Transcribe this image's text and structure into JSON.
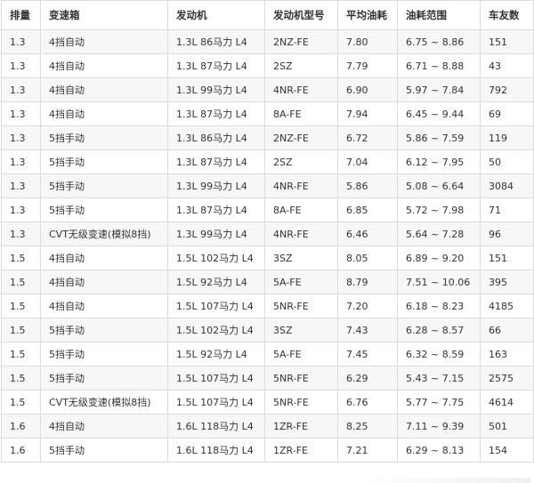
{
  "table": {
    "headers": [
      "排量",
      "变速箱",
      "发动机",
      "发动机型号",
      "平均油耗",
      "油耗范围",
      "车友数"
    ],
    "rows": [
      [
        "1.3",
        "4挡自动",
        "1.3L 86马力 L4",
        "2NZ-FE",
        "7.80",
        "6.75 ~ 8.86",
        "151"
      ],
      [
        "1.3",
        "4挡自动",
        "1.3L 87马力 L4",
        "2SZ",
        "7.79",
        "6.71 ~ 8.88",
        "43"
      ],
      [
        "1.3",
        "4挡自动",
        "1.3L 99马力 L4",
        "4NR-FE",
        "6.90",
        "5.97 ~ 7.84",
        "792"
      ],
      [
        "1.3",
        "4挡自动",
        "1.3L 87马力 L4",
        "8A-FE",
        "7.94",
        "6.45 ~ 9.44",
        "69"
      ],
      [
        "1.3",
        "5挡手动",
        "1.3L 86马力 L4",
        "2NZ-FE",
        "6.72",
        "5.86 ~ 7.59",
        "119"
      ],
      [
        "1.3",
        "5挡手动",
        "1.3L 87马力 L4",
        "2SZ",
        "7.04",
        "6.12 ~ 7.95",
        "50"
      ],
      [
        "1.3",
        "5挡手动",
        "1.3L 99马力 L4",
        "4NR-FE",
        "5.86",
        "5.08 ~ 6.64",
        "3084"
      ],
      [
        "1.3",
        "5挡手动",
        "1.3L 87马力 L4",
        "8A-FE",
        "6.85",
        "5.72 ~ 7.98",
        "71"
      ],
      [
        "1.3",
        "CVT无级变速(模拟8挡)",
        "1.3L 99马力 L4",
        "4NR-FE",
        "6.46",
        "5.64 ~ 7.28",
        "96"
      ],
      [
        "1.5",
        "4挡自动",
        "1.5L 102马力 L4",
        "3SZ",
        "8.05",
        "6.89 ~ 9.20",
        "151"
      ],
      [
        "1.5",
        "4挡自动",
        "1.5L 92马力 L4",
        "5A-FE",
        "8.79",
        "7.51 ~ 10.06",
        "395"
      ],
      [
        "1.5",
        "4挡自动",
        "1.5L 107马力 L4",
        "5NR-FE",
        "7.20",
        "6.18 ~ 8.23",
        "4185"
      ],
      [
        "1.5",
        "5挡手动",
        "1.5L 102马力 L4",
        "3SZ",
        "7.43",
        "6.28 ~ 8.57",
        "66"
      ],
      [
        "1.5",
        "5挡手动",
        "1.5L 92马力 L4",
        "5A-FE",
        "7.45",
        "6.32 ~ 8.59",
        "163"
      ],
      [
        "1.5",
        "5挡手动",
        "1.5L 107马力 L4",
        "5NR-FE",
        "6.29",
        "5.43 ~ 7.15",
        "2575"
      ],
      [
        "1.5",
        "CVT无级变速(模拟8挡)",
        "1.5L 107马力 L4",
        "5NR-FE",
        "6.76",
        "5.77 ~ 7.75",
        "4614"
      ],
      [
        "1.6",
        "4挡自动",
        "1.6L 118马力 L4",
        "1ZR-FE",
        "8.25",
        "7.11 ~ 9.39",
        "501"
      ],
      [
        "1.6",
        "5挡手动",
        "1.6L 118马力 L4",
        "1ZR-FE",
        "7.21",
        "6.29 ~ 8.13",
        "154"
      ]
    ]
  }
}
